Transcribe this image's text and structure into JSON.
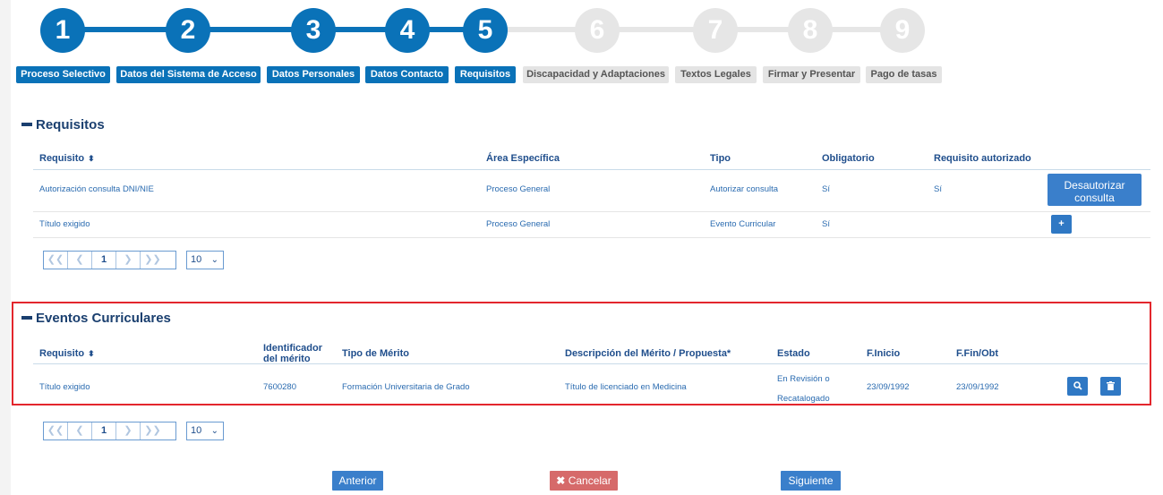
{
  "steps": [
    "1",
    "2",
    "3",
    "4",
    "5",
    "6",
    "7",
    "8",
    "9"
  ],
  "tabs": [
    "Proceso Selectivo",
    "Datos del Sistema de Acceso",
    "Datos Personales",
    "Datos Contacto",
    "Requisitos",
    "Discapacidad y Adaptaciones",
    "Textos Legales",
    "Firmar y Presentar",
    "Pago de tasas"
  ],
  "requisitos": {
    "title": "Requisitos",
    "headers": {
      "requisito": "Requisito",
      "area": "Área Específica",
      "tipo": "Tipo",
      "obligatorio": "Obligatorio",
      "autorizado": "Requisito autorizado"
    },
    "rows": [
      {
        "requisito": "Autorización consulta DNI/NIE",
        "area": "Proceso General",
        "tipo": "Autorizar consulta",
        "obligatorio": "Sí",
        "autorizado": "Sí",
        "action": "Desautorizar consulta"
      },
      {
        "requisito": "Título exigido",
        "area": "Proceso General",
        "tipo": "Evento Curricular",
        "obligatorio": "Sí",
        "autorizado": "",
        "action": "+"
      }
    ],
    "pager": {
      "page": "1",
      "page_size": "10"
    }
  },
  "eventos": {
    "title": "Eventos Curriculares",
    "headers": {
      "requisito": "Requisito",
      "identificador": "Identificador del mérito",
      "tipo": "Tipo de Mérito",
      "descripcion": "Descripción del Mérito / Propuesta*",
      "estado": "Estado",
      "inicio": "F.Inicio",
      "fin": "F.Fin/Obt"
    },
    "rows": [
      {
        "requisito": "Título exigido",
        "identificador": "7600280",
        "tipo": "Formación Universitaria de Grado",
        "descripcion": "Título de licenciado en Medicina",
        "estado": "En Revisión o Recatalogado",
        "inicio": "23/09/1992",
        "fin": "23/09/1992"
      }
    ],
    "pager": {
      "page": "1",
      "page_size": "10"
    }
  },
  "footer": {
    "anterior": "Anterior",
    "cancelar": "Cancelar",
    "siguiente": "Siguiente"
  }
}
